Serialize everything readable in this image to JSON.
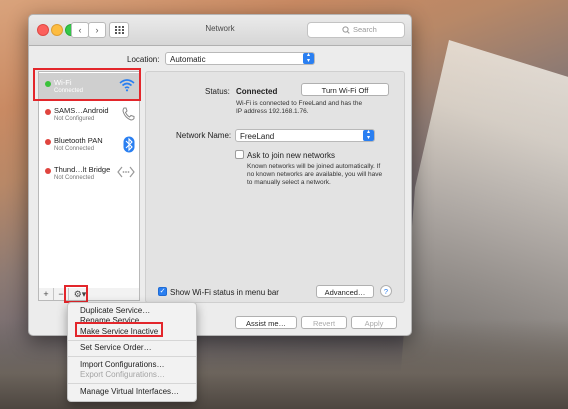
{
  "window": {
    "title": "Network"
  },
  "search": {
    "placeholder": "Search"
  },
  "location": {
    "label": "Location:",
    "value": "Automatic"
  },
  "services": [
    {
      "name": "Wi-Fi",
      "status": "Connected",
      "color": "#3ac23a",
      "icon": "wifi-icon"
    },
    {
      "name": "SAMS…Android",
      "status": "Not Configured",
      "color": "#e0443e",
      "icon": "phone-icon"
    },
    {
      "name": "Bluetooth PAN",
      "status": "Not Connected",
      "color": "#e0443e",
      "icon": "bluetooth-icon"
    },
    {
      "name": "Thund…lt Bridge",
      "status": "Not Connected",
      "color": "#e0443e",
      "icon": "thunderbolt-bridge-icon"
    }
  ],
  "toolbar": {
    "add": "+",
    "remove": "−",
    "gear": "⚙▾"
  },
  "detail": {
    "status_label": "Status:",
    "status_value": "Connected",
    "turn_off_button": "Turn Wi-Fi Off",
    "status_desc_1": "Wi-Fi is connected to FreeLand and has the",
    "status_desc_2": "IP address 192.168.1.76.",
    "network_name_label": "Network Name:",
    "network_name_value": "FreeLand",
    "ask_join_label": "Ask to join new networks",
    "ask_desc_1": "Known networks will be joined automatically. If",
    "ask_desc_2": "no known networks are available, you will have",
    "ask_desc_3": "to manually select a network.",
    "show_status_label": "Show Wi-Fi status in menu bar",
    "advanced_button": "Advanced…",
    "help_button": "?"
  },
  "footer": {
    "assist": "Assist me…",
    "revert": "Revert",
    "apply": "Apply"
  },
  "menu": {
    "items": [
      {
        "label": "Duplicate Service…",
        "enabled": true
      },
      {
        "label": "Rename Service…",
        "enabled": true
      },
      {
        "label": "Make Service Inactive",
        "enabled": true
      },
      {
        "label": "Set Service Order…",
        "enabled": true
      },
      {
        "label": "Import Configurations…",
        "enabled": true
      },
      {
        "label": "Export Configurations…",
        "enabled": false
      },
      {
        "label": "Manage Virtual Interfaces…",
        "enabled": true
      }
    ]
  },
  "colors": {
    "highlight": "#e3262b",
    "accent": "#2a7ff1"
  }
}
